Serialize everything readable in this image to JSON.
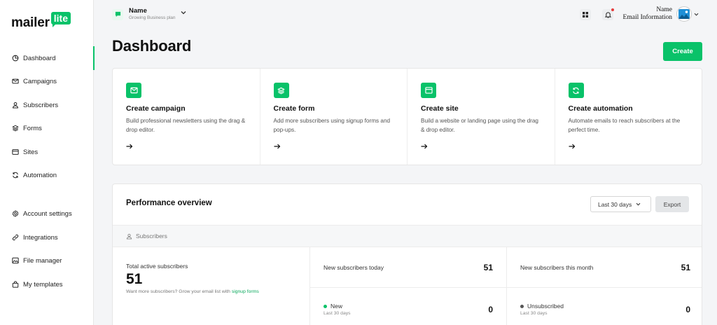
{
  "brand": {
    "name": "mailer",
    "badge": "lite",
    "accent": "#09c269"
  },
  "sidebar": {
    "items": [
      {
        "label": "Dashboard",
        "icon": "dashboard-icon",
        "active": true
      },
      {
        "label": "Campaigns",
        "icon": "envelope-icon"
      },
      {
        "label": "Subscribers",
        "icon": "user-icon"
      },
      {
        "label": "Forms",
        "icon": "layers-icon"
      },
      {
        "label": "Sites",
        "icon": "browser-icon"
      },
      {
        "label": "Automation",
        "icon": "sync-icon"
      },
      {
        "label": "Account settings",
        "icon": "gear-icon"
      },
      {
        "label": "Integrations",
        "icon": "link-icon"
      },
      {
        "label": "File manager",
        "icon": "image-icon"
      },
      {
        "label": "My templates",
        "icon": "bag-icon"
      }
    ]
  },
  "header": {
    "account_name": "Name",
    "account_plan": "Growing Business plan",
    "user_name": "Name",
    "user_info": "Email Information"
  },
  "page": {
    "title": "Dashboard",
    "create_label": "Create"
  },
  "cards": [
    {
      "title": "Create campaign",
      "desc": "Build professional newsletters using the drag & drop editor.",
      "icon": "envelope-icon"
    },
    {
      "title": "Create form",
      "desc": "Add more subscribers using signup forms and pop-ups.",
      "icon": "layers-icon"
    },
    {
      "title": "Create site",
      "desc": "Build a website or landing page using the drag & drop editor.",
      "icon": "browser-icon"
    },
    {
      "title": "Create automation",
      "desc": "Automate emails to reach subscribers at the perfect time.",
      "icon": "sync-icon"
    }
  ],
  "performance": {
    "title": "Performance overview",
    "range": "Last 30 days",
    "export_label": "Export",
    "section": "Subscribers",
    "total_label": "Total active subscribers",
    "total_value": "51",
    "total_sub_text": "Want more subscribers? Grow your email list with ",
    "total_sub_link": "signup forms",
    "stats": [
      {
        "label": "New subscribers today",
        "value": "51"
      },
      {
        "label": "New subscribers this month",
        "value": "51"
      },
      {
        "label": "New",
        "sub": "Last 30 days",
        "value": "0",
        "dot_color": "#09c269"
      },
      {
        "label": "Unsubscribed",
        "sub": "Last 30 days",
        "value": "0",
        "dot_color": "#555555"
      }
    ]
  }
}
